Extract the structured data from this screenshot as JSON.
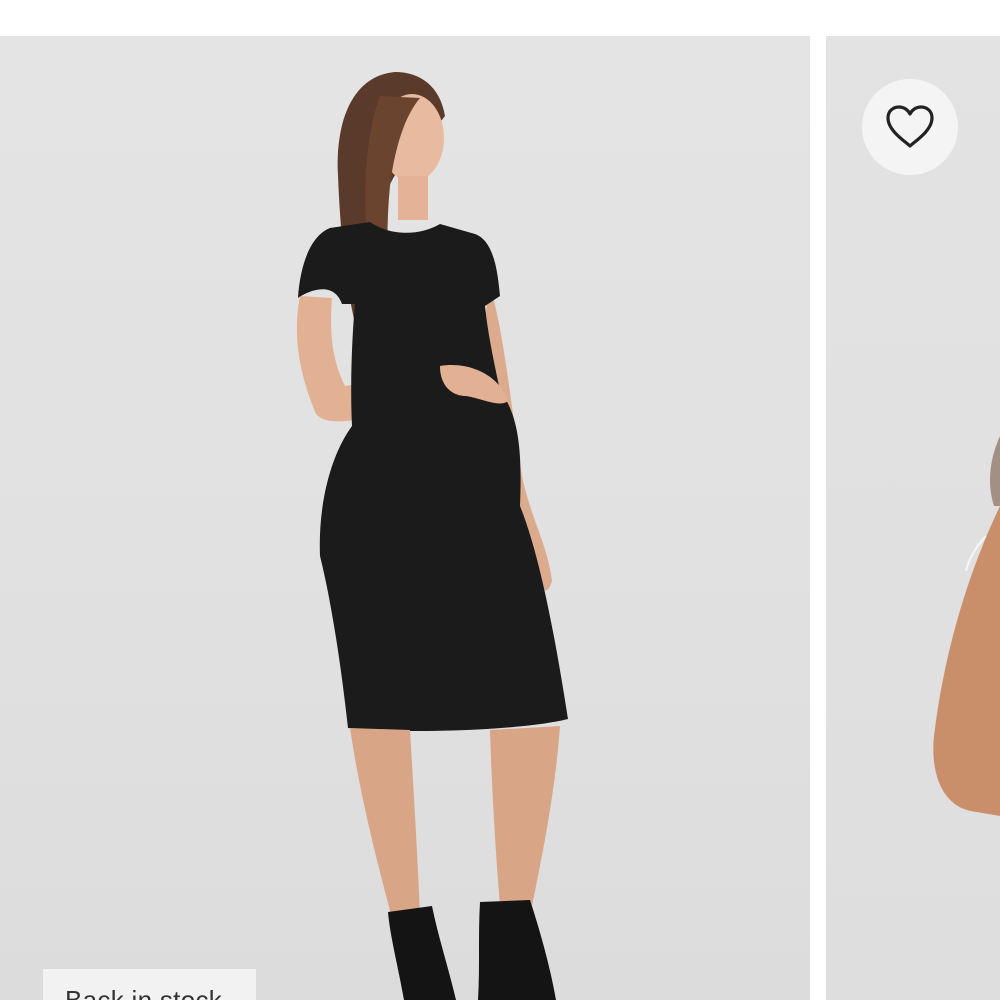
{
  "product_gallery": {
    "main_image": {
      "description_icon": "model-photo",
      "badge_label": "Back in stock"
    },
    "next_image": {
      "wishlist_icon": "heart-outline-icon"
    }
  },
  "colors": {
    "page_background": "#ffffff",
    "photo_background": "#e2e2e2",
    "badge_background": "#f2f2f2",
    "badge_text": "#333333",
    "wishlist_button_background": "#f4f4f4",
    "dress": "#1b1b1b"
  }
}
